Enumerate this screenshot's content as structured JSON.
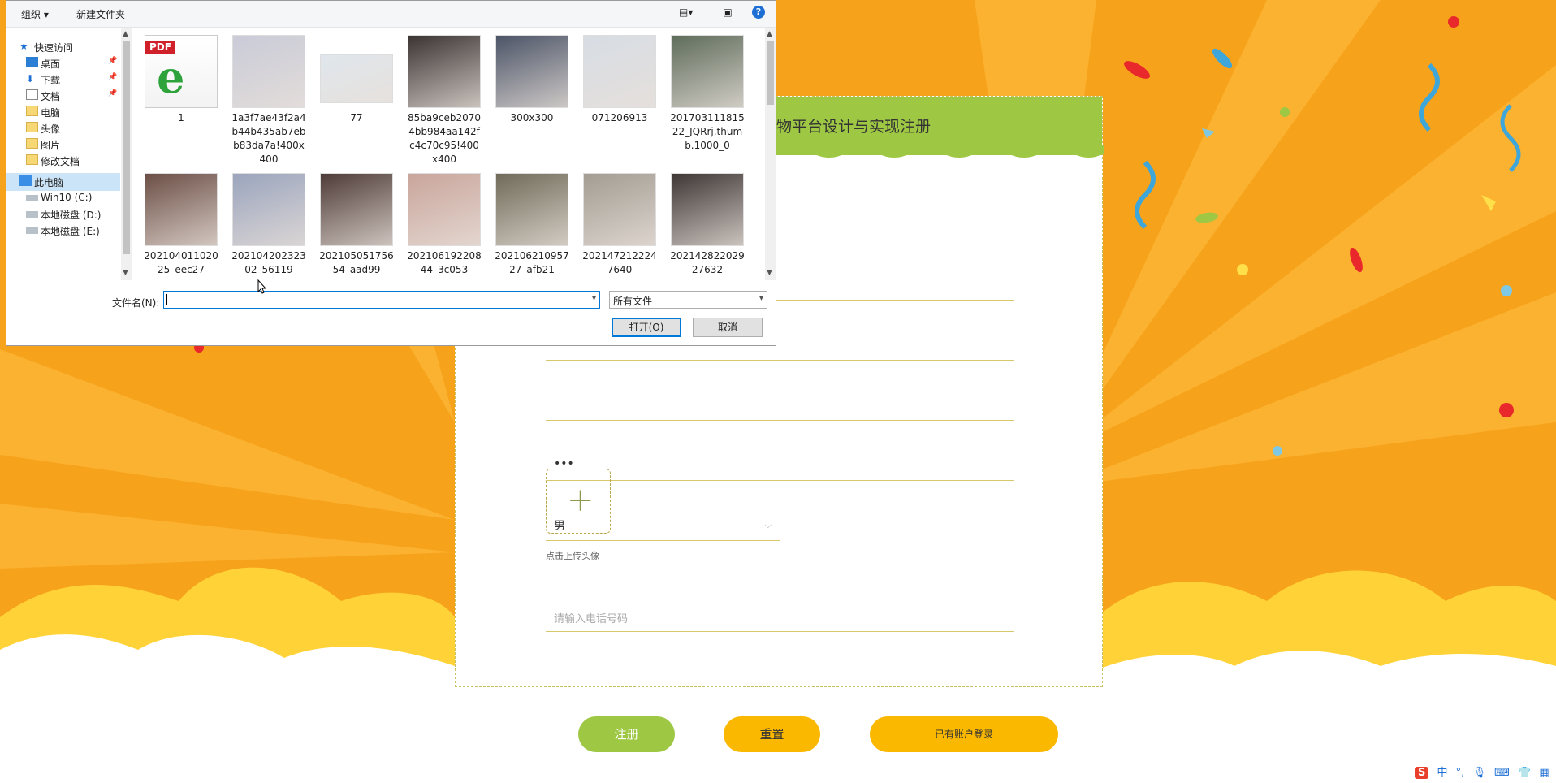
{
  "dialog": {
    "toolbar": {
      "organize": "组织 ▾",
      "new_folder": "新建文件夹",
      "help": "?"
    },
    "nav": [
      {
        "label": "快速访问",
        "icon": "star-icon",
        "pinned": false
      },
      {
        "label": "桌面",
        "icon": "desktop-icon",
        "pinned": true
      },
      {
        "label": "下载",
        "icon": "download-arrow-icon",
        "pinned": true
      },
      {
        "label": "文档",
        "icon": "document-icon",
        "pinned": true
      },
      {
        "label": "电脑",
        "icon": "folder-icon",
        "pinned": false
      },
      {
        "label": "头像",
        "icon": "folder-icon",
        "pinned": false
      },
      {
        "label": "图片",
        "icon": "folder-icon",
        "pinned": false
      },
      {
        "label": "修改文档",
        "icon": "folder-icon",
        "pinned": false
      },
      {
        "label": "此电脑",
        "icon": "computer-icon",
        "pinned": false
      },
      {
        "label": "Win10 (C:)",
        "icon": "drive-icon",
        "pinned": false
      },
      {
        "label": "本地磁盘 (D:)",
        "icon": "drive-icon",
        "pinned": false
      },
      {
        "label": "本地磁盘 (E:)",
        "icon": "drive-icon",
        "pinned": false
      }
    ],
    "files": [
      {
        "name": "1",
        "kind": "pdf",
        "badge": "PDF"
      },
      {
        "name": "1a3f7ae43f2a4b44b435ab7ebb83da7a!400x400",
        "kind": "photo",
        "color": "#c9cbd8"
      },
      {
        "name": "77",
        "kind": "photo",
        "color": "#dfe6ec"
      },
      {
        "name": "85ba9ceb20704bb984aa142fc4c70c95!400x400",
        "kind": "photo",
        "color": "#3a3231"
      },
      {
        "name": "300x300",
        "kind": "photo",
        "color": "#4a5366"
      },
      {
        "name": "071206913",
        "kind": "photo",
        "color": "#d7dde4"
      },
      {
        "name": "20170311181522_JQRrj.thumb.1000_0",
        "kind": "photo",
        "color": "#5d6b5a"
      },
      {
        "name": "20210401102025_eec27",
        "kind": "photo",
        "color": "#6b4e45"
      },
      {
        "name": "20210420232302_56119",
        "kind": "photo",
        "color": "#9aa4bd"
      },
      {
        "name": "20210505175654_aad99",
        "kind": "photo",
        "color": "#4d3a36"
      },
      {
        "name": "20210619220844_3c053",
        "kind": "photo",
        "color": "#c9a59b"
      },
      {
        "name": "20210621095727_afb21",
        "kind": "photo",
        "color": "#6f6a58"
      },
      {
        "name": "2021472122247640",
        "kind": "photo",
        "color": "#a39c92"
      },
      {
        "name": "20214282202927632",
        "kind": "photo",
        "color": "#3d3533"
      }
    ],
    "filename_label": "文件名(N):",
    "filename_value": "",
    "filetype_value": "所有文件",
    "open_label": "打开(O)",
    "cancel_label": "取消"
  },
  "form": {
    "title_visible": "物平台设计与实现注册",
    "password_dots": "•••",
    "gender_value": "男",
    "upload_label": "点击上传头像",
    "phone_placeholder": "请输入电话号码"
  },
  "buttons": {
    "register": "注册",
    "reset": "重置",
    "login": "已有账户登录"
  },
  "ime": {
    "logo": "S",
    "lang": "中"
  },
  "colors": {
    "background_orange": "#f7a21b",
    "accent_green": "#9ec744",
    "accent_yellow": "#fbb800",
    "dialog_blue": "#0078d7"
  }
}
